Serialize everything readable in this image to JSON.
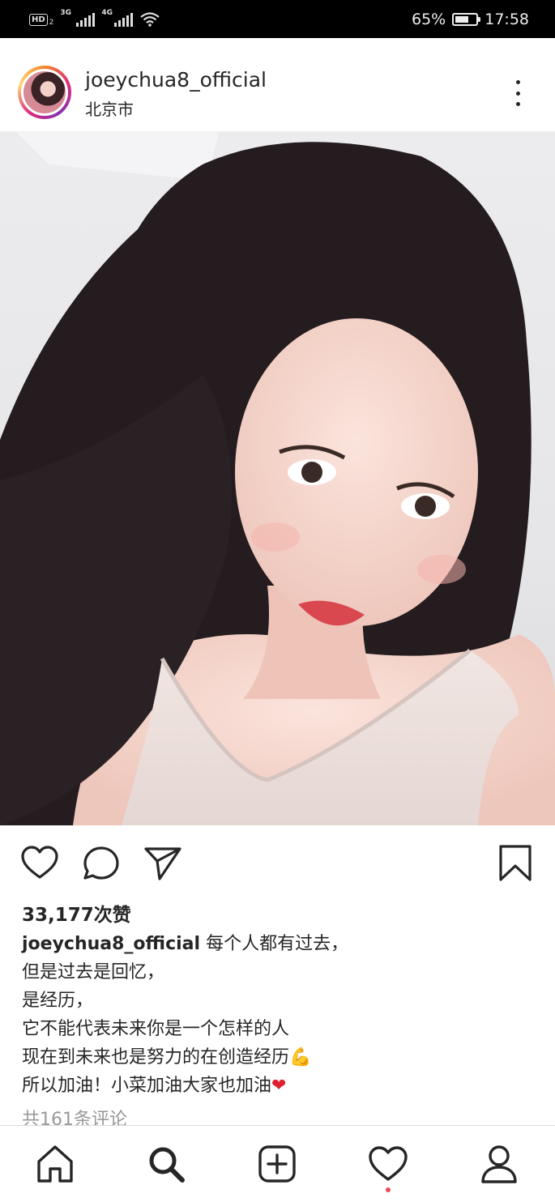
{
  "status_bar": {
    "hd_label": "HD",
    "hd_sub": "2",
    "sim1_label": "3G",
    "sim2_label": "4G",
    "battery_percent_text": "65%",
    "battery_level": 0.65,
    "time": "17:58"
  },
  "post": {
    "username": "joeychua8_official",
    "location": "北京市",
    "likes_text": "33,177次赞",
    "caption_user": "joeychua8_official",
    "caption_first": "每个人都有过去，",
    "caption_lines": [
      "但是过去是回忆，",
      "是经历，",
      "它不能代表未来你是一个怎样的人",
      "现在到未来也是努力的在创造经历",
      "所以加油！小菜加油大家也加油"
    ],
    "emoji_muscle": "💪",
    "emoji_heart": "❤",
    "comments_link": "共161条评论"
  },
  "icons": {
    "like": "heart-outline-icon",
    "comment": "speech-bubble-icon",
    "share": "paper-plane-icon",
    "save": "bookmark-icon",
    "home": "home-icon",
    "search": "search-icon",
    "new_post": "plus-square-icon",
    "activity": "heart-outline-icon",
    "profile": "person-icon"
  },
  "colors": {
    "text": "#262626",
    "muted": "#999999",
    "notification_dot": "#ed4956",
    "status_bar": "#000000"
  }
}
